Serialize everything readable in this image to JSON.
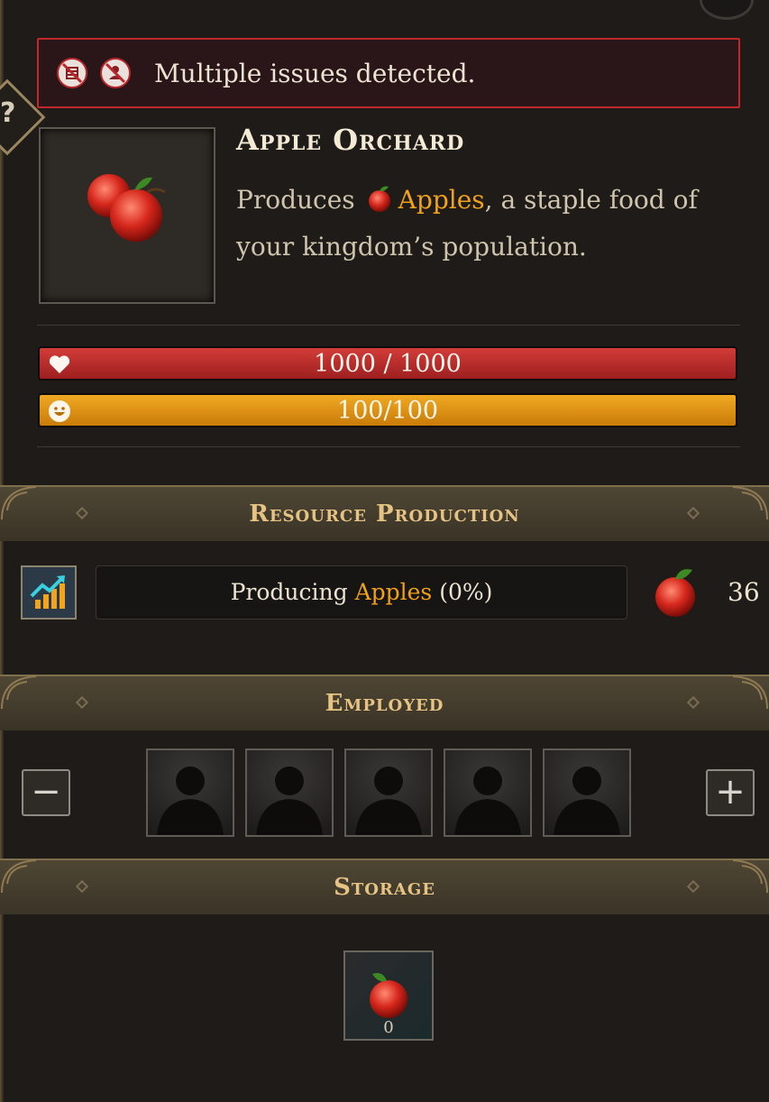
{
  "alert": {
    "icons": [
      "no-storage-icon",
      "no-workers-icon"
    ],
    "message": "Multiple issues detected."
  },
  "building": {
    "title": "Apple Orchard",
    "desc_pre": "Produces",
    "desc_resource": "Apples",
    "desc_post": ", a staple food of your kingdom’s population."
  },
  "stats": {
    "health_text": "1000 / 1000",
    "health_value": 1000,
    "health_max": 1000,
    "happiness_text": "100/100",
    "happiness_value": 100,
    "happiness_max": 100
  },
  "sections": {
    "production": "Resource Production",
    "employed": "Employed",
    "storage": "Storage"
  },
  "production": {
    "label_pre": "Producing",
    "resource": "Apples",
    "percent": "(0%)",
    "amount": "36"
  },
  "employed": {
    "slots": 5,
    "minus": "−",
    "plus": "+"
  },
  "storage": {
    "count": "0"
  },
  "colors": {
    "accent_gold": "#f0a21a",
    "alert_red": "#c2272b",
    "health_red": "#c22f2e",
    "happiness_orange": "#e79a17",
    "header_text": "#e6c383"
  }
}
